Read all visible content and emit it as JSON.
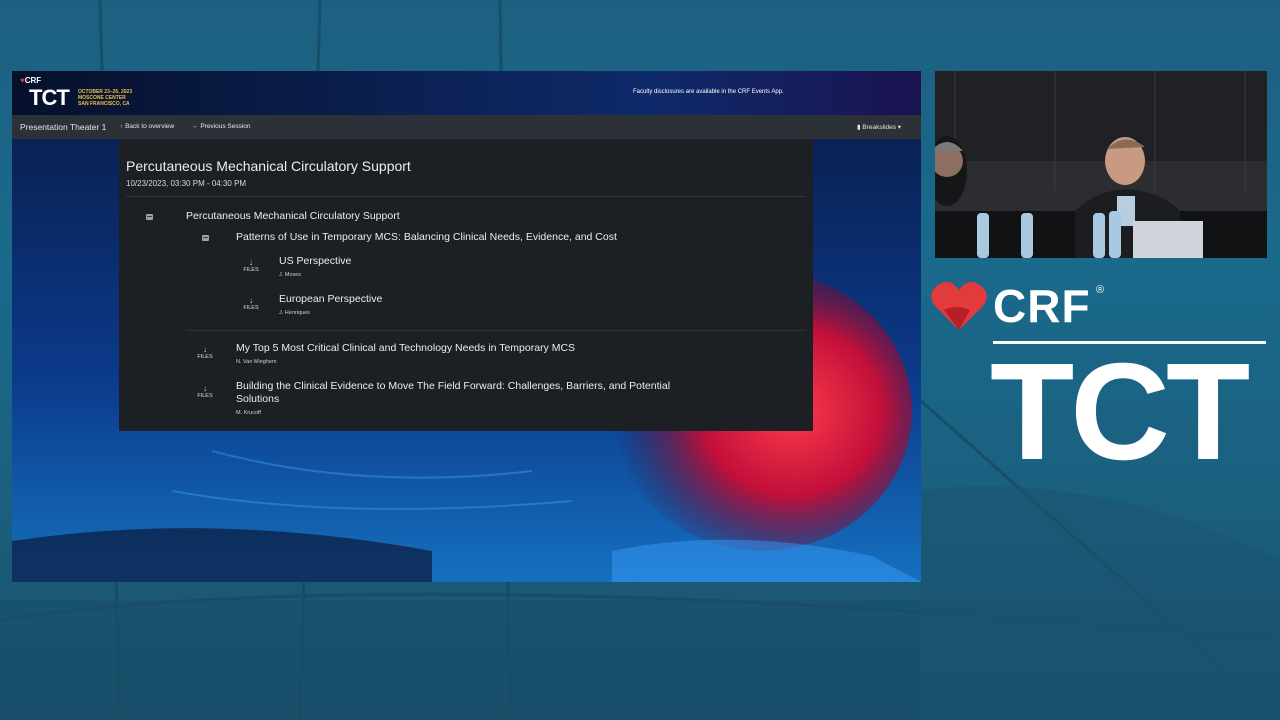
{
  "banner": {
    "brand": "CRF",
    "event": "TCT",
    "dates": "OCTOBER 23–26, 2023",
    "venue": "MOSCONE CENTER",
    "city": "SAN FRANCISCO, CA",
    "disclosure": "Faculty disclosures are available in the CRF Events App."
  },
  "navbar": {
    "room": "Presentation Theater 1",
    "back_label": "Back to overview",
    "prev_label": "Previous Session",
    "breakslides_label": "Breakslides"
  },
  "session": {
    "title": "Percutaneous Mechanical Circulatory Support",
    "time": "10/23/2023, 03:30 PM - 04:30 PM"
  },
  "agenda": {
    "section_title": "Percutaneous Mechanical Circulatory Support",
    "subsection_title": "Patterns of Use in Temporary MCS: Balancing Clinical Needs, Evidence, and Cost",
    "files_label": "FILES",
    "talks": [
      {
        "title": "US Perspective",
        "speaker": "J. Moses"
      },
      {
        "title": "European Perspective",
        "speaker": "J. Henriques"
      },
      {
        "title": "My Top 5 Most Critical Clinical and Technology Needs in Temporary MCS",
        "speaker": "N. Van Mieghem"
      },
      {
        "title": "Building the Clinical Evidence to Move The Field Forward: Challenges, Barriers, and Potential Solutions",
        "speaker": "M. Krucoff"
      }
    ]
  },
  "logo": {
    "brand": "CRF",
    "registered": "®",
    "event": "TCT"
  },
  "colors": {
    "background": "#1b6385",
    "panel": "#1c2024",
    "navbar": "#2b3136",
    "heart_red": "#e23b3b",
    "accent_gold": "#f0c040"
  }
}
